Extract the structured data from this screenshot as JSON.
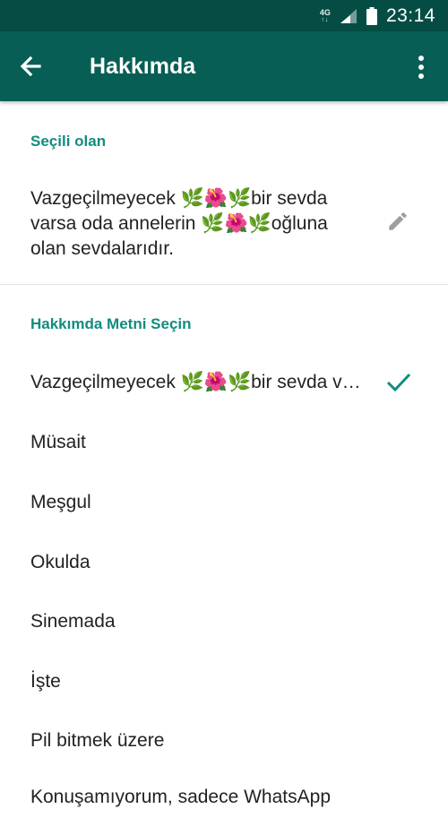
{
  "status_bar": {
    "network": "4G",
    "network_arrows": "↑↓",
    "time": "23:14"
  },
  "app_bar": {
    "title": "Hakkımda",
    "back_icon": "arrow-back-icon",
    "menu_icon": "more-vert-icon"
  },
  "current_section": {
    "header": "Seçili olan",
    "about_lines": [
      "Vazgeçilmeyecek 🌿🌺🌿bir sevda",
      "varsa oda annelerin 🌿🌺🌿oğluna",
      "olan sevdalarıdır."
    ],
    "edit_icon": "pencil-icon"
  },
  "select_section": {
    "header": "Hakkımda Metni Seçin",
    "options": [
      {
        "label": "Vazgeçilmeyecek 🌿🌺🌿bir sevda v…",
        "selected": true
      },
      {
        "label": "Müsait",
        "selected": false
      },
      {
        "label": "Meşgul",
        "selected": false
      },
      {
        "label": "Okulda",
        "selected": false
      },
      {
        "label": "Sinemada",
        "selected": false
      },
      {
        "label": "İşte",
        "selected": false
      },
      {
        "label": "Pil bitmek üzere",
        "selected": false
      },
      {
        "label": "Konuşamıyorum, sadece WhatsApp",
        "selected": false
      }
    ]
  },
  "colors": {
    "accent": "#128c7e",
    "app_bar": "#075e54",
    "status_bar": "#054d44",
    "text": "#222222"
  }
}
